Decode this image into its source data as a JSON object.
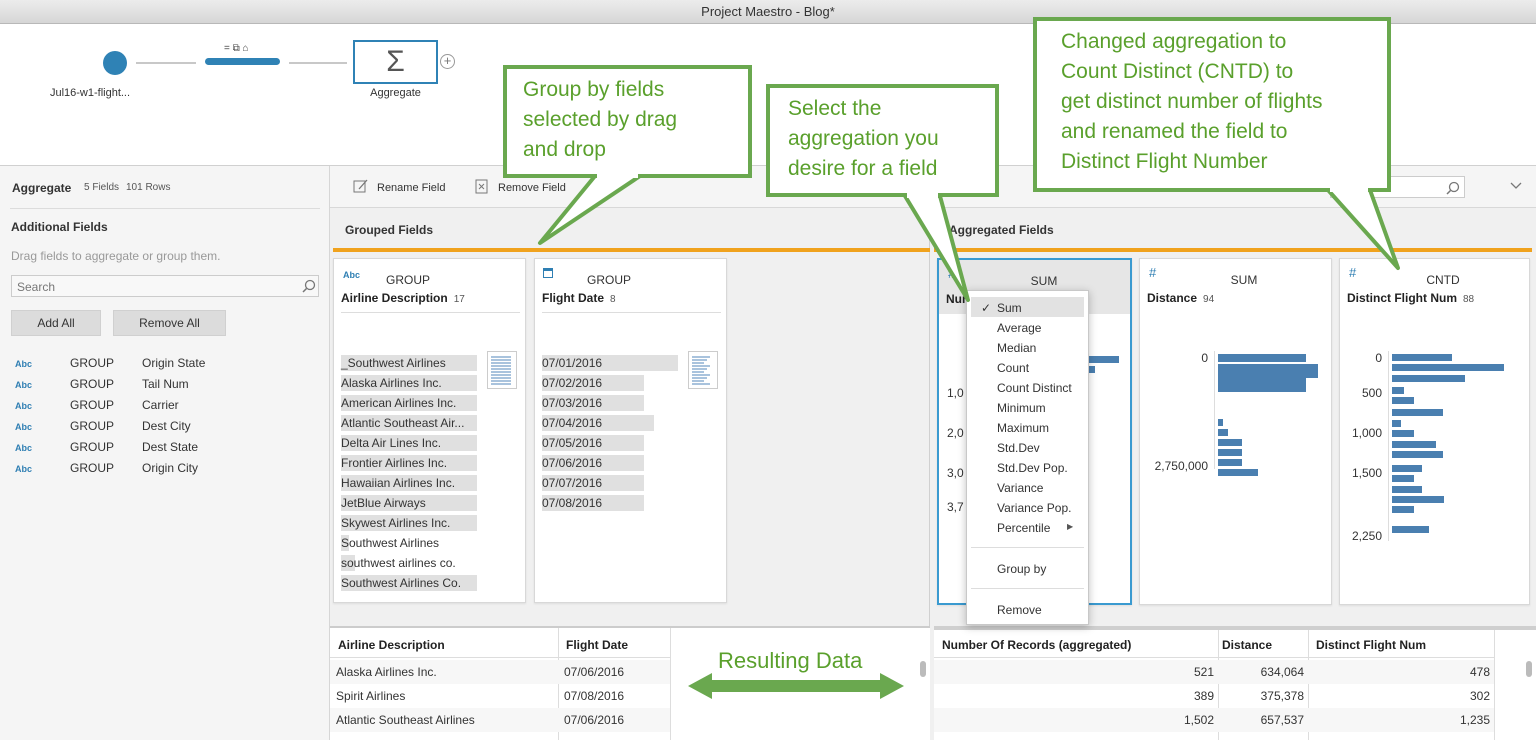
{
  "window": {
    "title": "Project Maestro - Blog*"
  },
  "flow": {
    "input_label": "Jul16-w1-flight...",
    "step_icons": "= ⧉ ⌂",
    "aggregate_symbol": "Σ",
    "aggregate_label": "Aggregate",
    "add_symbol": "+"
  },
  "panel": {
    "title": "Aggregate",
    "fields_count": "5 Fields",
    "rows_count": "101 Rows",
    "additional_title": "Additional Fields",
    "drag_hint": "Drag fields to aggregate or group them.",
    "search_placeholder": "Search",
    "add_all": "Add All",
    "remove_all": "Remove All",
    "fields": [
      {
        "type": "Abc",
        "role": "GROUP",
        "name": "Origin State"
      },
      {
        "type": "Abc",
        "role": "GROUP",
        "name": "Tail Num"
      },
      {
        "type": "Abc",
        "role": "GROUP",
        "name": "Carrier"
      },
      {
        "type": "Abc",
        "role": "GROUP",
        "name": "Dest City"
      },
      {
        "type": "Abc",
        "role": "GROUP",
        "name": "Dest State"
      },
      {
        "type": "Abc",
        "role": "GROUP",
        "name": "Origin City"
      }
    ]
  },
  "toolbar": {
    "rename": "Rename Field",
    "remove": "Remove Field"
  },
  "grouped": {
    "header": "Grouped Fields",
    "cards": [
      {
        "type": "Abc",
        "agg": "GROUP",
        "name": "Airline Description",
        "count": "17",
        "values": [
          "_Southwest Airlines",
          "Alaska Airlines Inc.",
          "American Airlines Inc.",
          "Atlantic Southeast Air...",
          "Delta Air Lines Inc.",
          "Frontier Airlines Inc.",
          "Hawaiian Airlines Inc.",
          "JetBlue Airways",
          "Skywest Airlines Inc.",
          "Southwest Airlines",
          "southwest airlines co.",
          "Southwest Airlines Co."
        ],
        "fills": [
          1,
          1,
          1,
          1,
          1,
          1,
          1,
          1,
          1,
          0.06,
          0.1,
          1
        ]
      },
      {
        "type": "date",
        "agg": "GROUP",
        "name": "Flight Date",
        "count": "8",
        "values": [
          "07/01/2016",
          "07/02/2016",
          "07/03/2016",
          "07/04/2016",
          "07/05/2016",
          "07/06/2016",
          "07/07/2016",
          "07/08/2016"
        ],
        "fills": [
          1,
          0.75,
          0.75,
          0.82,
          0.75,
          0.75,
          0.75,
          0.75
        ]
      }
    ]
  },
  "aggregated": {
    "header": "Aggregated Fields",
    "cards": [
      {
        "type": "#",
        "agg": "SUM",
        "name": "Num",
        "count": "",
        "ticks": [
          "1,0",
          "2,0",
          "3,0",
          "3,7"
        ]
      },
      {
        "type": "#",
        "agg": "SUM",
        "name": "Distance",
        "count": "94",
        "ticks": [
          "0",
          "2,750,000"
        ]
      },
      {
        "type": "#",
        "agg": "CNTD",
        "name": "Distinct Flight Num",
        "count": "88",
        "ticks": [
          "0",
          "500",
          "1,000",
          "1,500",
          "2,250"
        ]
      }
    ]
  },
  "menu": {
    "check": "✓",
    "items": [
      "Sum",
      "Average",
      "Median",
      "Count",
      "Count Distinct",
      "Minimum",
      "Maximum",
      "Std.Dev",
      "Std.Dev Pop.",
      "Variance",
      "Variance Pop.",
      "Percentile"
    ],
    "submenu_arrow": "▶",
    "group_by": "Group by",
    "remove": "Remove"
  },
  "results": {
    "left_headers": [
      "Airline Description",
      "Flight Date"
    ],
    "left_rows": [
      [
        "Alaska Airlines Inc.",
        "07/06/2016"
      ],
      [
        "Spirit Airlines",
        "07/08/2016"
      ],
      [
        "Atlantic Southeast Airlines",
        "07/06/2016"
      ]
    ],
    "right_headers": [
      "Number Of Records (aggregated)",
      "Distance",
      "Distinct Flight Num"
    ],
    "right_rows": [
      [
        "521",
        "634,064",
        "478"
      ],
      [
        "389",
        "375,378",
        "302"
      ],
      [
        "1,502",
        "657,537",
        "1,235"
      ]
    ]
  },
  "callouts": {
    "group": [
      "Group by fields",
      "selected by drag",
      "and drop"
    ],
    "select": [
      "Select the",
      "aggregation you",
      "desire for a field"
    ],
    "changed": [
      "Changed aggregation to",
      "Count Distinct (CNTD) to",
      "get distinct number of flights",
      "and renamed the field to",
      "Distinct Flight Number"
    ],
    "resulting": "Resulting Data"
  },
  "colors": {
    "accent_orange": "#f0a21d",
    "callout_green": "#6aa84f",
    "bar_blue": "#4a7fb0"
  }
}
